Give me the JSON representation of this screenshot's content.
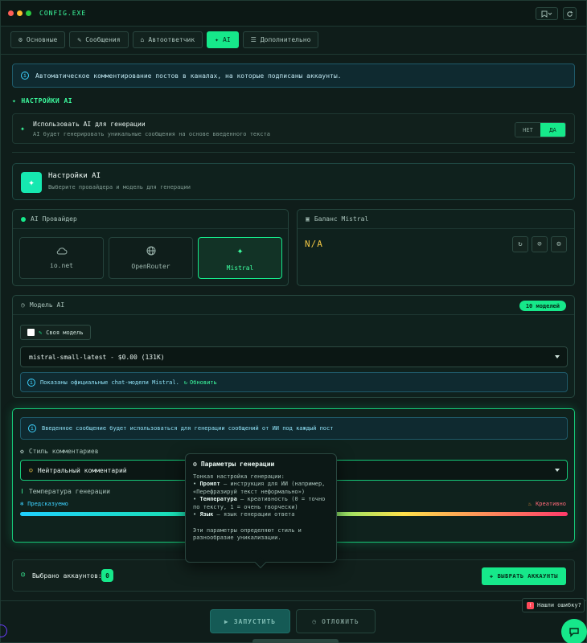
{
  "window": {
    "title": "CONFIG.EXE",
    "dots": [
      "#ff5f57",
      "#febc2e",
      "#28c840"
    ],
    "pin_icon": "bookmark-icon",
    "refresh_icon": "refresh-icon"
  },
  "tabs": [
    {
      "label": "Основные",
      "icon": "gear-icon"
    },
    {
      "label": "Сообщения",
      "icon": "edit-icon"
    },
    {
      "label": "Автоответчик",
      "icon": "robot-icon"
    },
    {
      "label": "AI",
      "icon": "sparkle-icon",
      "active": true
    },
    {
      "label": "Дополнительно",
      "icon": "sliders-icon"
    }
  ],
  "info_banner": "Автоматическое комментирование постов в каналах, на которые подписаны аккаунты.",
  "section_title": "НАСТРОЙКИ AI",
  "use_ai": {
    "title": "Использовать AI для генерации",
    "desc": "AI будет генерировать уникальные сообщения на основе введенного текста",
    "off": "НЕТ",
    "on": "ДА"
  },
  "ai_settings": {
    "title": "Настройки AI",
    "subtitle": "Выберите провайдера и модель для генерации"
  },
  "provider": {
    "header": "AI Провайдер",
    "items": [
      {
        "label": "io.net",
        "icon": "cloud-icon"
      },
      {
        "label": "OpenRouter",
        "icon": "globe-icon"
      },
      {
        "label": "Mistral",
        "icon": "sparkle-icon",
        "selected": true
      }
    ]
  },
  "balance": {
    "header": "Баланс Mistral",
    "value": "N/A"
  },
  "model": {
    "header": "Модель AI",
    "count_badge": "10 моделей",
    "custom_label": "Своя модель",
    "selected": "mistral-small-latest - $0.00 (131K)",
    "note": "Показаны официальные chat-модели Mistral.",
    "refresh": "Обновить"
  },
  "generation": {
    "note": "Введенное сообщение будет использоваться для генерации сообщений от ИИ под каждый пост",
    "style_label": "Стиль комментариев",
    "style_value": "Нейтральный комментарий",
    "temp_label": "Температура генерации",
    "temp_left": "Предсказуемо",
    "temp_right": "Креативно"
  },
  "tooltip": {
    "title": "Параметры генерации",
    "intro": "Тонкая настройка генерации:",
    "p1_b": "Промпт",
    "p1": " — инструкция для ИИ (например, «Перефразируй текст неформально»)",
    "p2_b": "Температура",
    "p2": " — креативность (0 = точно по тексту, 1 = очень творчески)",
    "p3_b": "Язык",
    "p3": " — язык генерации ответа",
    "outro": "Эти параметры определяют стиль и разнообразие уникализации."
  },
  "accounts": {
    "label": "Выбрано аккаунтов:",
    "count": "0",
    "button": "ВЫБРАТЬ АККАУНТЫ"
  },
  "actions": {
    "start": "ЗАПУСТИТЬ",
    "postpone": "ОТЛОЖИТЬ"
  },
  "bug": {
    "label": "Нашли ошибку?"
  },
  "colors": {
    "accent": "#16e88a",
    "bg": "#0f1d1a",
    "info": "#3dd2ff"
  }
}
